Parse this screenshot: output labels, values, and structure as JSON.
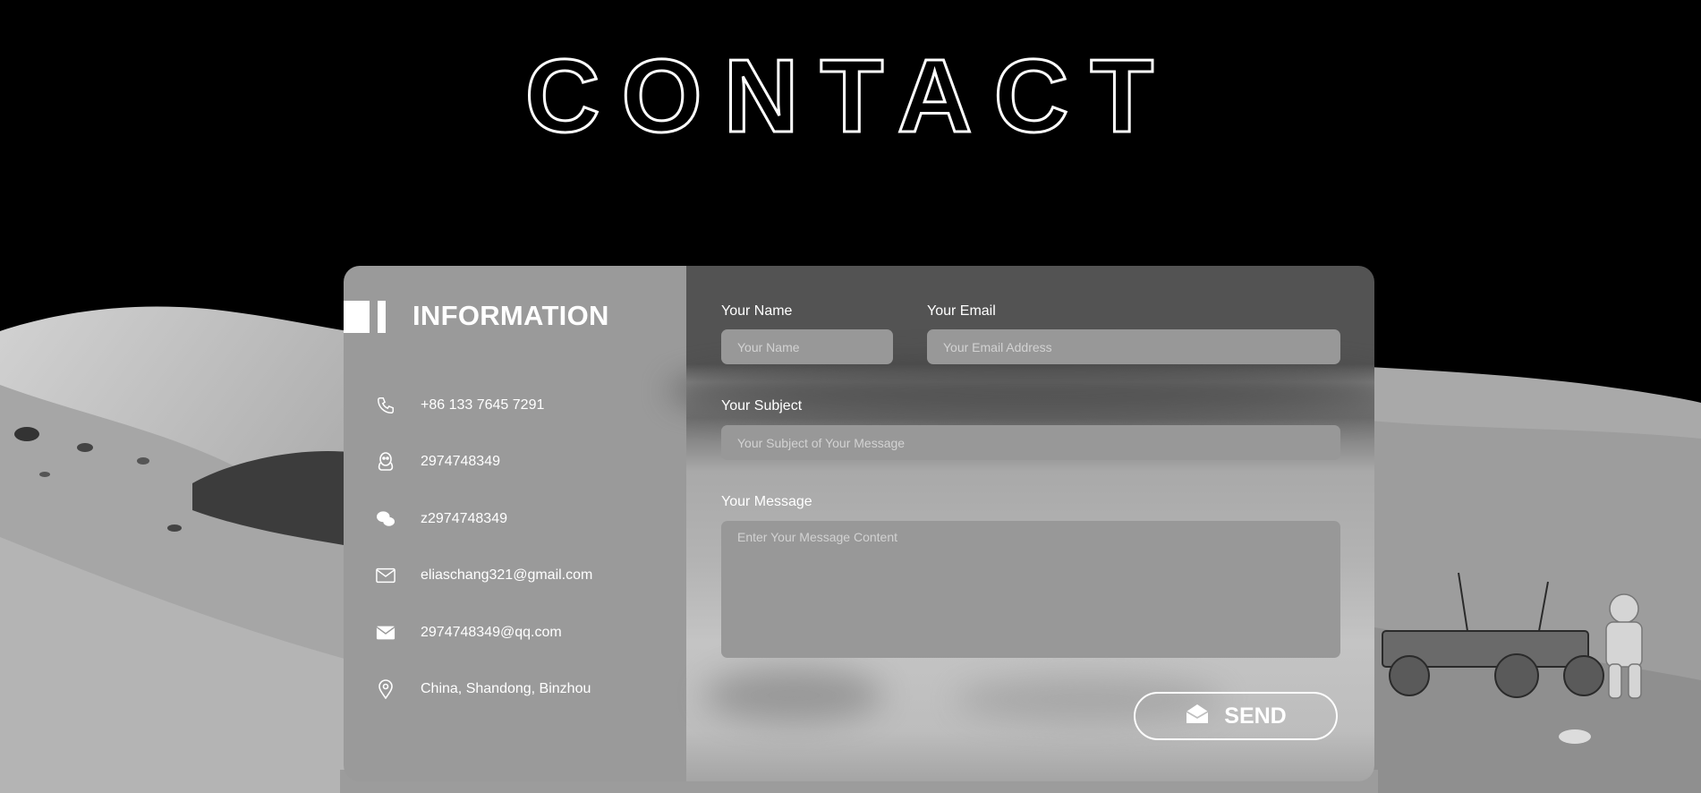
{
  "page": {
    "title": "CONTACT"
  },
  "info": {
    "heading": "INFORMATION",
    "items": [
      {
        "icon": "phone-icon",
        "text": "+86 133 7645 7291"
      },
      {
        "icon": "qq-icon",
        "text": "2974748349"
      },
      {
        "icon": "wechat-icon",
        "text": "z2974748349"
      },
      {
        "icon": "mail-outline-icon",
        "text": "eliaschang321@gmail.com"
      },
      {
        "icon": "mail-filled-icon",
        "text": "2974748349@qq.com"
      },
      {
        "icon": "location-pin-icon",
        "text": "China, Shandong, Binzhou"
      }
    ]
  },
  "form": {
    "name_label": "Your Name",
    "name_placeholder": "Your Name",
    "email_label": "Your Email",
    "email_placeholder": "Your Email Address",
    "subject_label": "Your Subject",
    "subject_placeholder": "Your Subject of Your Message",
    "message_label": "Your Message",
    "message_placeholder": "Enter Your Message Content",
    "send_label": "SEND"
  },
  "colors": {
    "background": "#000000",
    "info_panel": "#9a9a9a",
    "form_header": "#535353",
    "input": "#989898",
    "text": "#ffffff"
  }
}
